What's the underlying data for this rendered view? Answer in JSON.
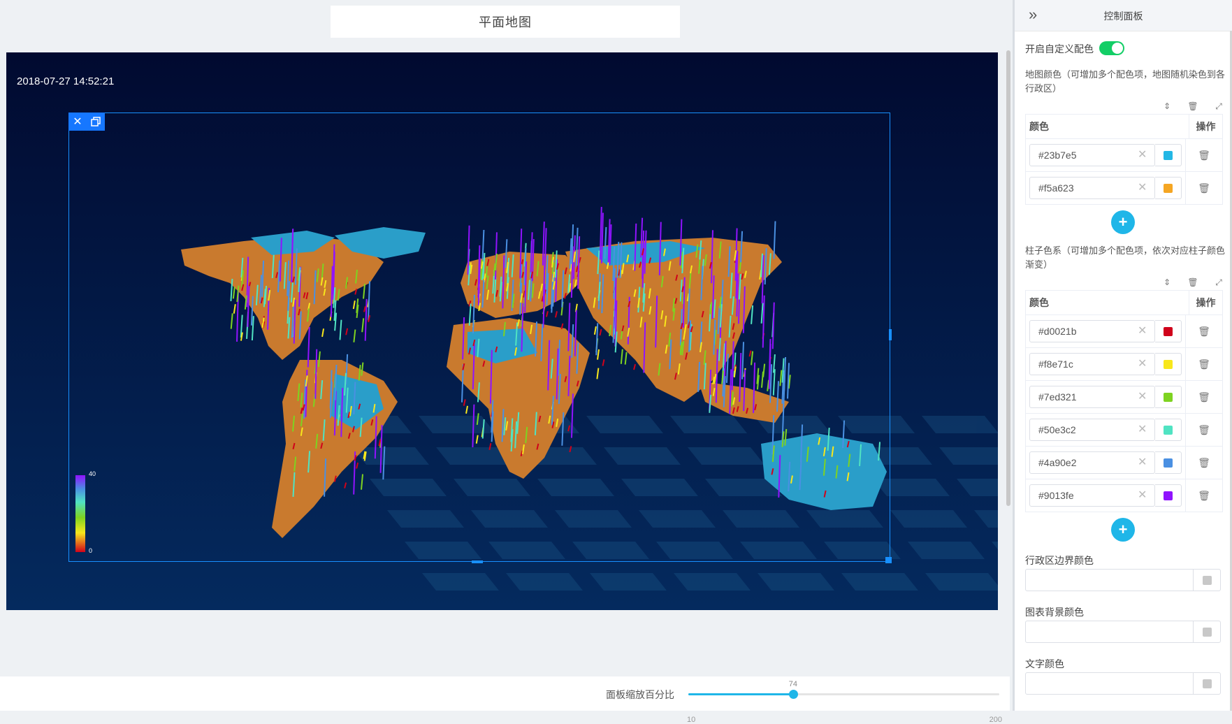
{
  "main": {
    "title": "平面地图",
    "timestamp": "2018-07-27 14:52:21",
    "legend": {
      "max": "40",
      "min": "0"
    }
  },
  "zoom": {
    "label": "面板缩放百分比",
    "value": 74,
    "min": 10,
    "max": 200
  },
  "panel": {
    "title": "控制面板",
    "custom_color_label": "开启自定义配色",
    "custom_color_enabled": true,
    "map_colors": {
      "desc": "地图颜色（可增加多个配色项，地图随机染色到各行政区）",
      "col_color": "颜色",
      "col_action": "操作",
      "items": [
        "#23b7e5",
        "#f5a623"
      ]
    },
    "bar_colors": {
      "desc": "柱子色系（可增加多个配色项，依次对应柱子颜色渐变）",
      "col_color": "颜色",
      "col_action": "操作",
      "items": [
        "#d0021b",
        "#f8e71c",
        "#7ed321",
        "#50e3c2",
        "#4a90e2",
        "#9013fe"
      ]
    },
    "border_color_label": "行政区边界颜色",
    "chart_bg_label": "图表背景颜色",
    "text_color_label": "文字颜色"
  },
  "colors": {
    "accent": "#1fb6e8",
    "toggle_on": "#13ce66",
    "canvas_bg": "#020c33",
    "selection": "#1890ff",
    "map_land_a": "#2a9ec9",
    "map_land_b": "#c97a2e"
  }
}
